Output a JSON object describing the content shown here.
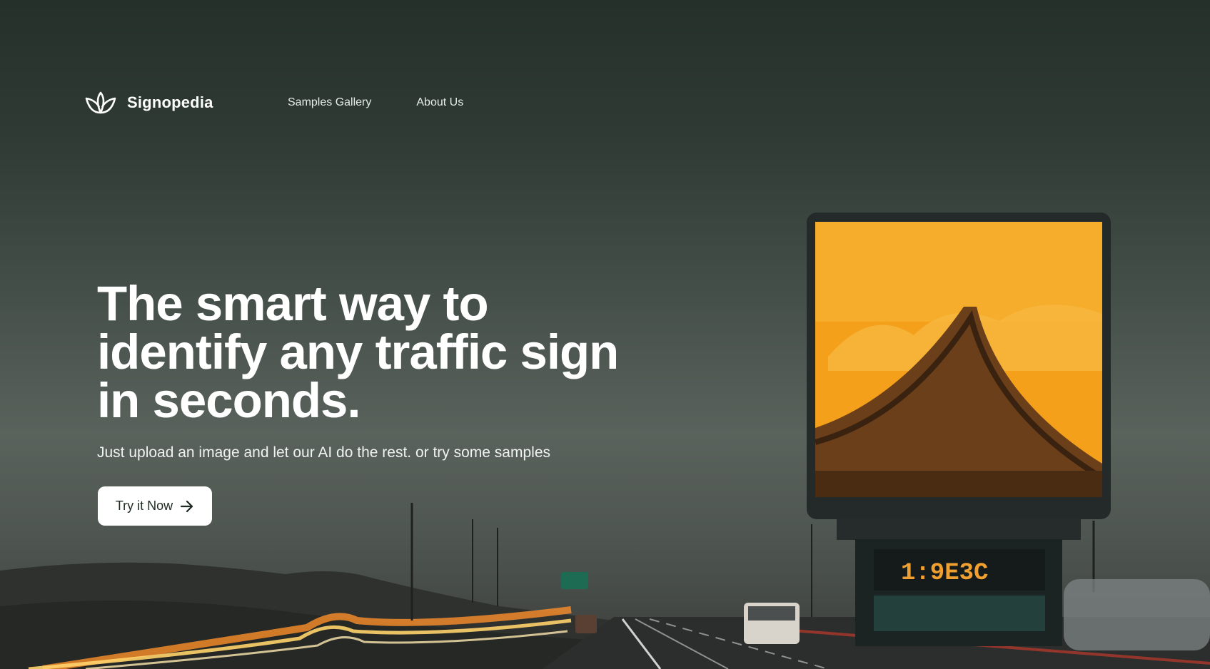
{
  "brand": {
    "name": "Signopedia",
    "logo_icon": "lotus-icon"
  },
  "nav": {
    "items": [
      "Samples Gallery",
      "About Us"
    ]
  },
  "hero": {
    "headline": "The smart way to identify any traffic sign in seconds.",
    "subtitle": "Just upload an image and let our AI do the rest. or try some samples"
  },
  "cta": {
    "label": "Try it Now",
    "icon": "arrow-right-icon"
  },
  "colors": {
    "accent_orange": "#f4a01a",
    "button_bg": "#ffffff",
    "button_text": "#1e2a22"
  }
}
